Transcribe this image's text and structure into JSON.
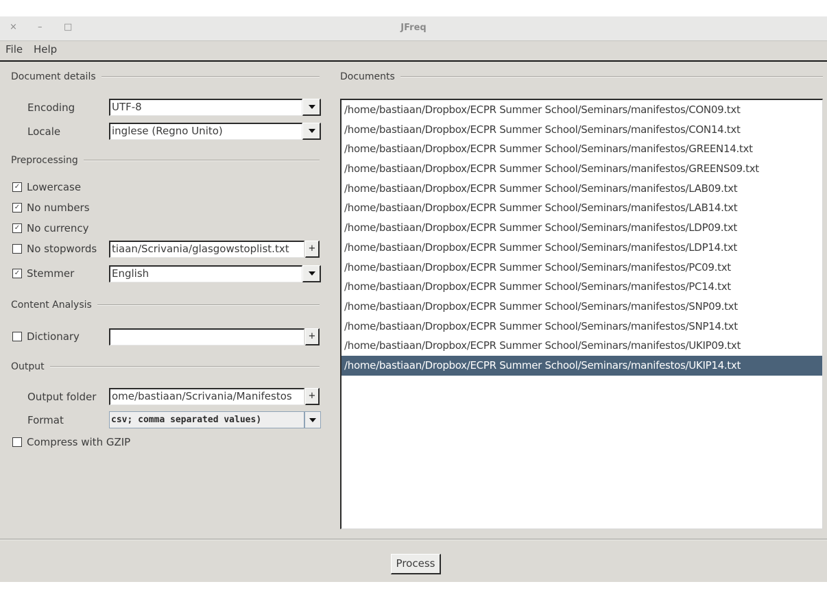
{
  "window": {
    "title": "JFreq",
    "controls": {
      "close": "×",
      "minimize": "–",
      "maximize": "□"
    }
  },
  "menu": [
    "File",
    "Help"
  ],
  "document_details": {
    "heading": "Document details",
    "encoding": {
      "label": "Encoding",
      "value": "UTF-8"
    },
    "locale": {
      "label": "Locale",
      "value": "inglese (Regno Unito)"
    }
  },
  "preprocessing": {
    "heading": "Preprocessing",
    "lowercase": {
      "label": "Lowercase",
      "checked": true
    },
    "no_numbers": {
      "label": "No numbers",
      "checked": true
    },
    "no_currency": {
      "label": "No currency",
      "checked": true
    },
    "no_stopwords": {
      "label": "No stopwords",
      "checked": false,
      "value": "tiaan/Scrivania/glasgowstoplist.txt",
      "add": "+"
    },
    "stemmer": {
      "label": "Stemmer",
      "checked": true,
      "value": "English"
    }
  },
  "content_analysis": {
    "heading": "Content Analysis",
    "dictionary": {
      "label": "Dictionary",
      "checked": false,
      "value": "",
      "add": "+"
    }
  },
  "output": {
    "heading": "Output",
    "folder": {
      "label": "Output folder",
      "value": "ome/bastiaan/Scrivania/Manifestos",
      "add": "+"
    },
    "format": {
      "label": "Format",
      "value": "csv; comma separated values)"
    },
    "compress": {
      "label": "Compress with GZIP",
      "checked": false
    }
  },
  "documents": {
    "heading": "Documents",
    "selected_index": 13,
    "items": [
      "/home/bastiaan/Dropbox/ECPR Summer School/Seminars/manifestos/CON09.txt",
      "/home/bastiaan/Dropbox/ECPR Summer School/Seminars/manifestos/CON14.txt",
      "/home/bastiaan/Dropbox/ECPR Summer School/Seminars/manifestos/GREEN14.txt",
      "/home/bastiaan/Dropbox/ECPR Summer School/Seminars/manifestos/GREENS09.txt",
      "/home/bastiaan/Dropbox/ECPR Summer School/Seminars/manifestos/LAB09.txt",
      "/home/bastiaan/Dropbox/ECPR Summer School/Seminars/manifestos/LAB14.txt",
      "/home/bastiaan/Dropbox/ECPR Summer School/Seminars/manifestos/LDP09.txt",
      "/home/bastiaan/Dropbox/ECPR Summer School/Seminars/manifestos/LDP14.txt",
      "/home/bastiaan/Dropbox/ECPR Summer School/Seminars/manifestos/PC09.txt",
      "/home/bastiaan/Dropbox/ECPR Summer School/Seminars/manifestos/PC14.txt",
      "/home/bastiaan/Dropbox/ECPR Summer School/Seminars/manifestos/SNP09.txt",
      "/home/bastiaan/Dropbox/ECPR Summer School/Seminars/manifestos/SNP14.txt",
      "/home/bastiaan/Dropbox/ECPR Summer School/Seminars/manifestos/UKIP09.txt",
      "/home/bastiaan/Dropbox/ECPR Summer School/Seminars/manifestos/UKIP14.txt"
    ]
  },
  "process_button": "Process",
  "colors": {
    "selection": "#4a6279",
    "window_bg": "#dcdad5"
  }
}
